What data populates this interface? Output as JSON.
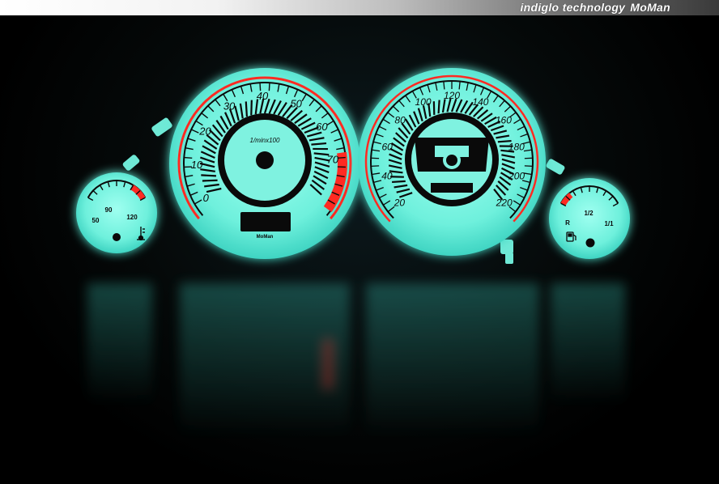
{
  "header": {
    "tagline": "indiglo technology",
    "brand": "MoMan"
  },
  "colors": {
    "glow": "#7ff2e0",
    "glow_dark": "#2fcab8",
    "red": "#ff2a22",
    "ink": "#0a0a0a"
  },
  "tachometer": {
    "labels": [
      "0",
      "10",
      "20",
      "30",
      "40",
      "50",
      "60",
      "70"
    ],
    "unit": "1/minx100",
    "maker": "MoMan"
  },
  "speedometer": {
    "labels": [
      "20",
      "40",
      "60",
      "80",
      "100",
      "120",
      "140",
      "160",
      "180",
      "200",
      "220"
    ]
  },
  "temp_gauge": {
    "labels": [
      "50",
      "90",
      "120"
    ],
    "icon": "thermometer-icon"
  },
  "fuel_gauge": {
    "labels": [
      "R",
      "1/2",
      "1/1"
    ],
    "icon": "fuel-pump-icon"
  }
}
